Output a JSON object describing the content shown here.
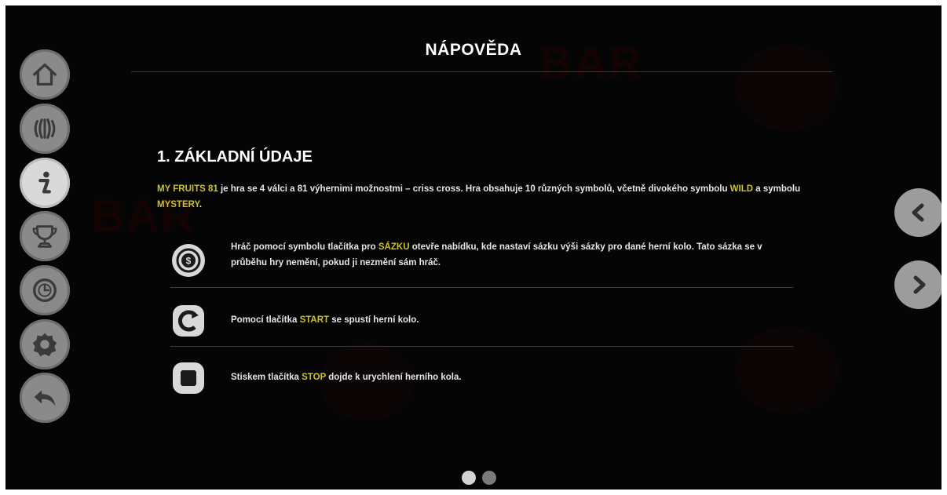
{
  "title": "NÁPOVĚDA",
  "section": {
    "heading": "1. ZÁKLADNÍ ÚDAJE"
  },
  "intro": {
    "game_name": "MY FRUITS 81",
    "text_1": " je hra se 4 válci a 81 výhernimi možnostmi – criss cross. Hra obsahuje 10 různých symbolů, včetně divokého symbolu ",
    "wild": "WILD",
    "text_2": " a symbolu ",
    "mystery": "MYSTERY",
    "text_3": "."
  },
  "rows": [
    {
      "icon": "coin-bet-icon",
      "before": "Hráč pomocí symbolu tlačítka pro ",
      "highlight": "SÁZKU",
      "after": " otevře nabídku, kde nastaví sázku výši sázky pro dané herní kolo. Tato sázka se v průběhu hry nemění, pokud ji nezmění sám hráč."
    },
    {
      "icon": "start-spin-icon",
      "before": "Pomocí tlačítka ",
      "highlight": "START",
      "after": " se spustí herní kolo."
    },
    {
      "icon": "stop-icon",
      "before": "Stiskem tlačítka ",
      "highlight": "STOP",
      "after": " dojde k urychlení herního kola."
    }
  ],
  "rail": [
    "home-icon",
    "reels-icon",
    "info-icon",
    "trophy-icon",
    "history-icon",
    "settings-icon",
    "back-icon"
  ],
  "nav": [
    "prev-page-icon",
    "next-page-icon"
  ],
  "pagination": {
    "current": 1,
    "total": 2
  },
  "colors": {
    "highlight": "#c9c12f",
    "background": "#050505",
    "button": "#8a8a8a"
  }
}
